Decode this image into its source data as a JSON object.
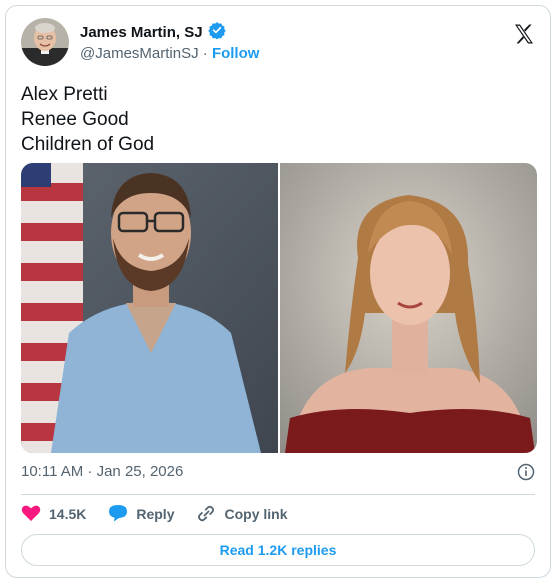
{
  "author": {
    "name": "James Martin, SJ",
    "handle": "@JamesMartinSJ",
    "separator": "·",
    "follow_label": "Follow"
  },
  "tweet": {
    "lines": [
      "Alex Pretti",
      "Renee Good",
      "Children of God"
    ]
  },
  "meta": {
    "timestamp": "10:11 AM · Jan 25, 2026"
  },
  "actions": {
    "like_count": "14.5K",
    "reply_label": "Reply",
    "copy_label": "Copy link"
  },
  "footer": {
    "read_replies_label": "Read 1.2K replies"
  },
  "colors": {
    "accent": "#1d9bf0",
    "like": "#f91880",
    "muted": "#536471"
  }
}
